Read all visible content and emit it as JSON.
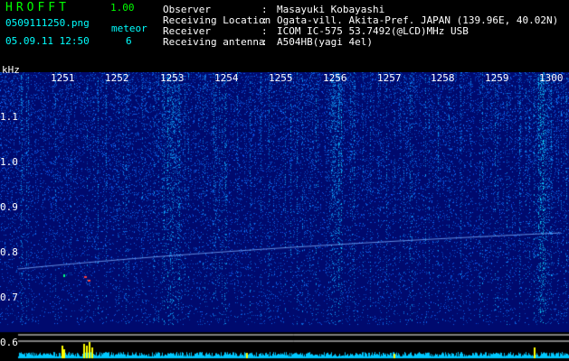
{
  "app": {
    "title": "HROFFT",
    "version": "1.00"
  },
  "file": {
    "name": "0509111250.png",
    "datetime": "05.09.11 12:50"
  },
  "meteor": {
    "label": "meteor",
    "count": "6"
  },
  "info": [
    {
      "label": "Observer",
      "value": "Masayuki Kobayashi"
    },
    {
      "label": "Receiving Location",
      "value": "Ogata-vill. Akita-Pref. JAPAN (139.96E, 40.02N)"
    },
    {
      "label": "Receiver",
      "value": "ICOM IC-575 53.7492(@LCD)MHz USB"
    },
    {
      "label": "Receiving antenna",
      "value": "A504HB(yagi 4el)"
    }
  ],
  "separator": ":",
  "axis": {
    "y_unit": "kHz",
    "y_ticks": [
      "1.1",
      "1.0",
      "0.9",
      "0.8",
      "0.7",
      "0.6"
    ],
    "x_ticks": [
      "1251",
      "1252",
      "1253",
      "1254",
      "1255",
      "1256",
      "1257",
      "1258",
      "1259",
      "1300"
    ]
  },
  "colors": {
    "background": "#000000",
    "header_green": "#00ff00",
    "header_cyan": "#00ffff",
    "spectrogram_base": "#000a6e",
    "signal_level": "#00c8ff",
    "meteor_spike": "#ffff00"
  }
}
